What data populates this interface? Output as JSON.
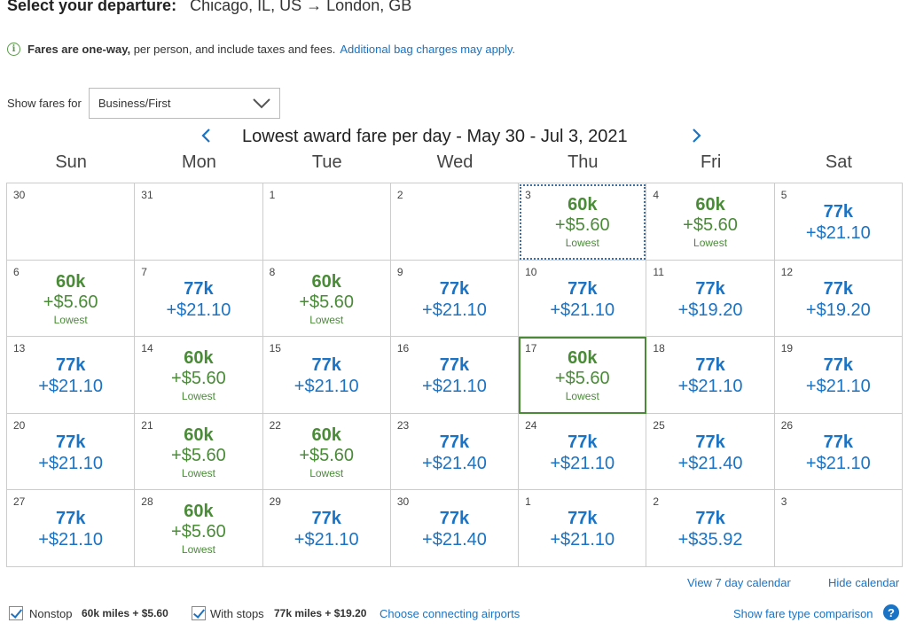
{
  "header": {
    "label": "Select your departure:",
    "route": "Chicago, IL, US → London, GB"
  },
  "info": {
    "bold": "Fares are one-way,",
    "text": " per person, and include taxes and fees.",
    "link": "Additional bag charges may apply."
  },
  "fares_filter": {
    "label": "Show fares for",
    "selected": "Business/First"
  },
  "calendar": {
    "title": "Lowest award fare per day - May 30 - Jul 3, 2021",
    "days_of_week": [
      "Sun",
      "Mon",
      "Tue",
      "Wed",
      "Thu",
      "Fri",
      "Sat"
    ],
    "weeks": [
      [
        {
          "day": "30",
          "miles": "",
          "tax": "",
          "tag": "",
          "kind": "empty"
        },
        {
          "day": "31",
          "miles": "",
          "tax": "",
          "tag": "",
          "kind": "empty"
        },
        {
          "day": "1",
          "miles": "",
          "tax": "",
          "tag": "",
          "kind": "empty"
        },
        {
          "day": "2",
          "miles": "",
          "tax": "",
          "tag": "",
          "kind": "empty"
        },
        {
          "day": "3",
          "miles": "60k",
          "tax": "+$5.60",
          "tag": "Lowest",
          "kind": "low",
          "state": "today"
        },
        {
          "day": "4",
          "miles": "60k",
          "tax": "+$5.60",
          "tag": "Lowest",
          "kind": "low"
        },
        {
          "day": "5",
          "miles": "77k",
          "tax": "+$21.10",
          "tag": "",
          "kind": "reg"
        }
      ],
      [
        {
          "day": "6",
          "miles": "60k",
          "tax": "+$5.60",
          "tag": "Lowest",
          "kind": "low"
        },
        {
          "day": "7",
          "miles": "77k",
          "tax": "+$21.10",
          "tag": "",
          "kind": "reg"
        },
        {
          "day": "8",
          "miles": "60k",
          "tax": "+$5.60",
          "tag": "Lowest",
          "kind": "low"
        },
        {
          "day": "9",
          "miles": "77k",
          "tax": "+$21.10",
          "tag": "",
          "kind": "reg"
        },
        {
          "day": "10",
          "miles": "77k",
          "tax": "+$21.10",
          "tag": "",
          "kind": "reg"
        },
        {
          "day": "11",
          "miles": "77k",
          "tax": "+$19.20",
          "tag": "",
          "kind": "reg"
        },
        {
          "day": "12",
          "miles": "77k",
          "tax": "+$19.20",
          "tag": "",
          "kind": "reg"
        }
      ],
      [
        {
          "day": "13",
          "miles": "77k",
          "tax": "+$21.10",
          "tag": "",
          "kind": "reg"
        },
        {
          "day": "14",
          "miles": "60k",
          "tax": "+$5.60",
          "tag": "Lowest",
          "kind": "low"
        },
        {
          "day": "15",
          "miles": "77k",
          "tax": "+$21.10",
          "tag": "",
          "kind": "reg"
        },
        {
          "day": "16",
          "miles": "77k",
          "tax": "+$21.10",
          "tag": "",
          "kind": "reg"
        },
        {
          "day": "17",
          "miles": "60k",
          "tax": "+$5.60",
          "tag": "Lowest",
          "kind": "low",
          "state": "selected"
        },
        {
          "day": "18",
          "miles": "77k",
          "tax": "+$21.10",
          "tag": "",
          "kind": "reg"
        },
        {
          "day": "19",
          "miles": "77k",
          "tax": "+$21.10",
          "tag": "",
          "kind": "reg"
        }
      ],
      [
        {
          "day": "20",
          "miles": "77k",
          "tax": "+$21.10",
          "tag": "",
          "kind": "reg"
        },
        {
          "day": "21",
          "miles": "60k",
          "tax": "+$5.60",
          "tag": "Lowest",
          "kind": "low"
        },
        {
          "day": "22",
          "miles": "60k",
          "tax": "+$5.60",
          "tag": "Lowest",
          "kind": "low"
        },
        {
          "day": "23",
          "miles": "77k",
          "tax": "+$21.40",
          "tag": "",
          "kind": "reg"
        },
        {
          "day": "24",
          "miles": "77k",
          "tax": "+$21.10",
          "tag": "",
          "kind": "reg"
        },
        {
          "day": "25",
          "miles": "77k",
          "tax": "+$21.40",
          "tag": "",
          "kind": "reg"
        },
        {
          "day": "26",
          "miles": "77k",
          "tax": "+$21.10",
          "tag": "",
          "kind": "reg"
        }
      ],
      [
        {
          "day": "27",
          "miles": "77k",
          "tax": "+$21.10",
          "tag": "",
          "kind": "reg"
        },
        {
          "day": "28",
          "miles": "60k",
          "tax": "+$5.60",
          "tag": "Lowest",
          "kind": "low"
        },
        {
          "day": "29",
          "miles": "77k",
          "tax": "+$21.10",
          "tag": "",
          "kind": "reg"
        },
        {
          "day": "30",
          "miles": "77k",
          "tax": "+$21.40",
          "tag": "",
          "kind": "reg"
        },
        {
          "day": "1",
          "miles": "77k",
          "tax": "+$21.10",
          "tag": "",
          "kind": "reg"
        },
        {
          "day": "2",
          "miles": "77k",
          "tax": "+$35.92",
          "tag": "",
          "kind": "reg"
        },
        {
          "day": "3",
          "miles": "",
          "tax": "",
          "tag": "",
          "kind": "empty"
        }
      ]
    ]
  },
  "links": {
    "view_7day": "View 7 day calendar",
    "hide": "Hide calendar"
  },
  "filters": {
    "nonstop_label": "Nonstop",
    "nonstop_fare": "60k miles + $5.60",
    "stops_label": "With stops",
    "stops_fare": "77k miles + $19.20",
    "connect_link": "Choose connecting airports",
    "compare_link": "Show fare type comparison"
  },
  "colors": {
    "lowest_green": "#4a8b38",
    "link_blue": "#1a73c4",
    "grid_border": "#cccccc"
  },
  "icons": {
    "info": "info-circle-icon",
    "prev": "chevron-left-icon",
    "next": "chevron-right-icon",
    "dropdown": "chevron-down-icon",
    "help": "help-circle-icon",
    "checkbox": "checkmark-icon"
  }
}
